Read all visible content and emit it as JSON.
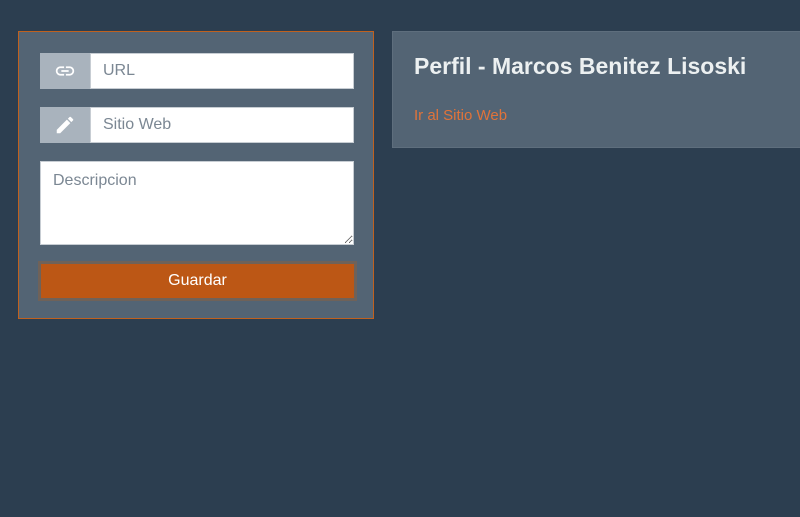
{
  "form": {
    "url_field": {
      "placeholder": "URL",
      "value": "",
      "icon": "link-icon"
    },
    "website_field": {
      "placeholder": "Sitio Web",
      "value": "",
      "icon": "pencil-icon"
    },
    "description_field": {
      "placeholder": "Descripcion",
      "value": ""
    },
    "save_label": "Guardar"
  },
  "profile": {
    "title": "Perfil - Marcos Benitez Lisoski",
    "link_label": "Ir al Sitio Web"
  },
  "colors": {
    "background": "#2c3e50",
    "panel": "#536474",
    "accent": "#bc5715",
    "link": "#e0733a"
  }
}
